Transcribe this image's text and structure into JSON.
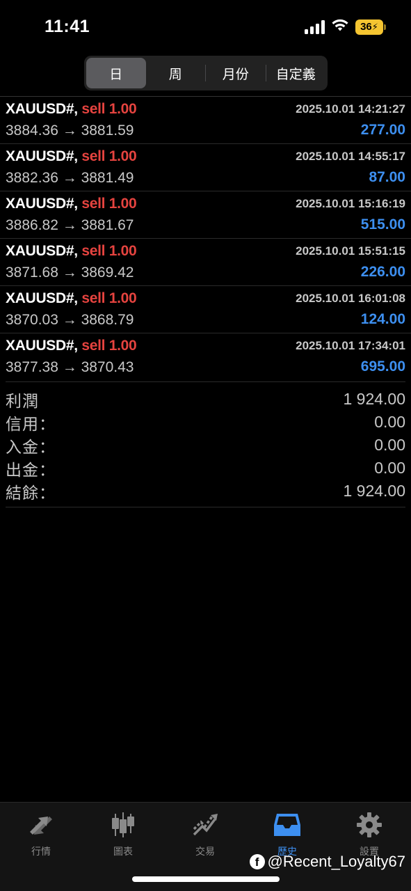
{
  "status_bar": {
    "time": "11:41",
    "battery": "36"
  },
  "period_tabs": [
    {
      "label": "日",
      "active": true
    },
    {
      "label": "周",
      "active": false
    },
    {
      "label": "月份",
      "active": false
    },
    {
      "label": "自定義",
      "active": false
    }
  ],
  "trades": [
    {
      "symbol": "XAUUSD#,",
      "side": "sell 1.00",
      "time": "2025.10.01 14:21:27",
      "prices": "3884.36 → 3881.59",
      "profit": "277.00"
    },
    {
      "symbol": "XAUUSD#,",
      "side": "sell 1.00",
      "time": "2025.10.01 14:55:17",
      "prices": "3882.36 → 3881.49",
      "profit": "87.00"
    },
    {
      "symbol": "XAUUSD#,",
      "side": "sell 1.00",
      "time": "2025.10.01 15:16:19",
      "prices": "3886.82 → 3881.67",
      "profit": "515.00"
    },
    {
      "symbol": "XAUUSD#,",
      "side": "sell 1.00",
      "time": "2025.10.01 15:51:15",
      "prices": "3871.68 → 3869.42",
      "profit": "226.00"
    },
    {
      "symbol": "XAUUSD#,",
      "side": "sell 1.00",
      "time": "2025.10.01 16:01:08",
      "prices": "3870.03 → 3868.79",
      "profit": "124.00"
    },
    {
      "symbol": "XAUUSD#,",
      "side": "sell 1.00",
      "time": "2025.10.01 17:34:01",
      "prices": "3877.38 → 3870.43",
      "profit": "695.00"
    }
  ],
  "summary": [
    {
      "label": "利潤",
      "value": "1 924.00"
    },
    {
      "label": "信用：",
      "value": "0.00"
    },
    {
      "label": "入金：",
      "value": "0.00"
    },
    {
      "label": "出金：",
      "value": "0.00"
    },
    {
      "label": "結餘：",
      "value": "1 924.00"
    }
  ],
  "tabs": [
    {
      "label": "行情",
      "icon": "quotes-icon",
      "active": false
    },
    {
      "label": "圖表",
      "icon": "candlestick-chart-icon",
      "active": false
    },
    {
      "label": "交易",
      "icon": "trade-trend-icon",
      "active": false
    },
    {
      "label": "歷史",
      "icon": "history-inbox-icon",
      "active": true
    },
    {
      "label": "設置",
      "icon": "gear-icon",
      "active": false
    }
  ],
  "watermark": {
    "text": "@Recent_Loyalty67",
    "icon": "facebook-icon"
  },
  "colors": {
    "sell": "#e5433f",
    "profit": "#3d8ff0",
    "active_tab": "#3d8ff0",
    "inactive_tab": "#8a8a8a"
  }
}
